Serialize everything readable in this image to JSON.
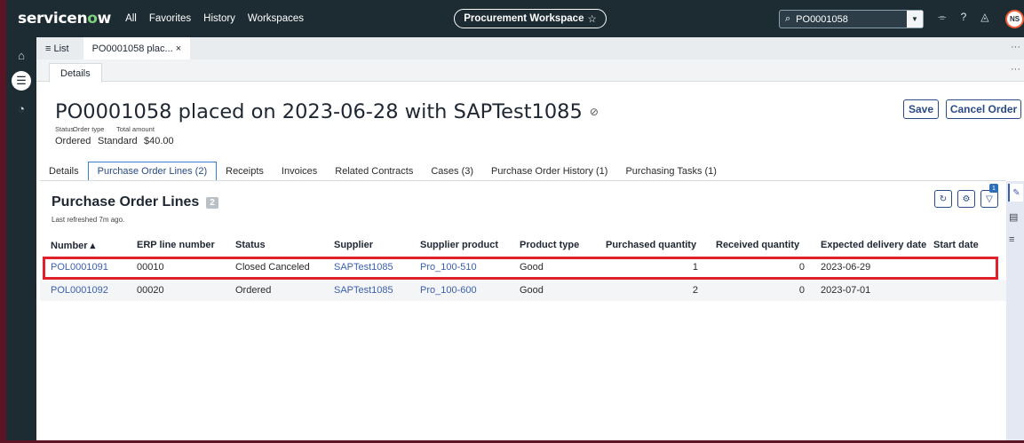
{
  "topbar": {
    "logo_pre": "servicen",
    "logo_o": "o",
    "logo_post": "w",
    "nav": [
      "All",
      "Favorites",
      "History",
      "Workspaces"
    ],
    "workspace": "Procurement Workspace",
    "workspace_star": "☆",
    "search_value": "PO0001058",
    "avatar": "NS"
  },
  "tabs": {
    "list_label": "≡ List",
    "record_tab": "PO0001058 plac... ×",
    "more": "···"
  },
  "subtab": {
    "label": "Details",
    "more": "···"
  },
  "record": {
    "title": "PO0001058 placed on 2023-06-28 with SAPTest1085",
    "status_label": "Status",
    "status_value": "Ordered",
    "order_type_label": "Order type",
    "order_type_value": "Standard",
    "total_label": "Total amount",
    "total_value": "$40.00",
    "save_label": "Save",
    "cancel_label": "Cancel Order"
  },
  "record_tabs": [
    "Details",
    "Purchase Order Lines (2)",
    "Receipts",
    "Invoices",
    "Related Contracts",
    "Cases (3)",
    "Purchase Order History (1)",
    "Purchasing Tasks (1)"
  ],
  "list": {
    "title": "Purchase Order Lines",
    "count": "2",
    "refreshed": "Last refreshed 7m ago.",
    "filter_badge": "1",
    "columns": [
      "Number ▴",
      "ERP line number",
      "Status",
      "Supplier",
      "Supplier product",
      "Product type",
      "Purchased quantity",
      "Received quantity",
      "Expected delivery date",
      "Start date"
    ],
    "rows": [
      [
        "POL0001091",
        "00010",
        "Closed Canceled",
        "SAPTest1085",
        "Pro_100-510",
        "Good",
        "1",
        "0",
        "2023-06-29",
        ""
      ],
      [
        "POL0001092",
        "00020",
        "Ordered",
        "SAPTest1085",
        "Pro_100-600",
        "Good",
        "2",
        "0",
        "2023-07-01",
        ""
      ]
    ]
  },
  "colors": {
    "topbar": "#1d2b33",
    "brand_green": "#7ed07c",
    "link": "#3b5fb0",
    "highlight": "#e0202a"
  }
}
